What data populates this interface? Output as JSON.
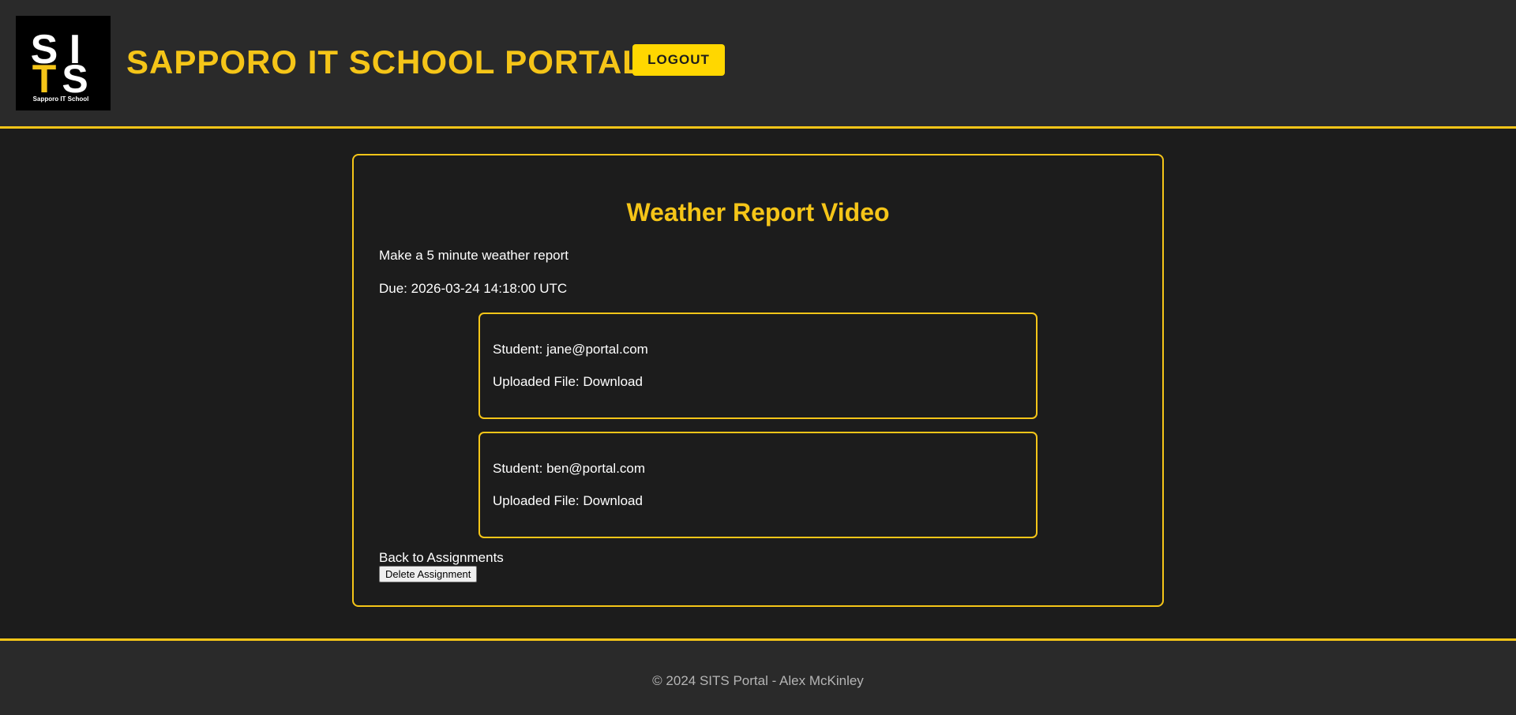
{
  "header": {
    "logo_letters": [
      "S",
      "I",
      "T",
      "S"
    ],
    "logo_caption": "Sapporo IT School",
    "title": "SAPPORO IT SCHOOL PORTAL",
    "logout_label": "LOGOUT"
  },
  "assignment": {
    "title": "Weather Report Video",
    "description": "Make a 5 minute weather report",
    "due": "Due: 2026-03-24 14:18:00 UTC"
  },
  "submissions": [
    {
      "student_prefix": "Student: ",
      "student": "jane@portal.com",
      "file_prefix": "Uploaded File: ",
      "file_link": "Download"
    },
    {
      "student_prefix": "Student: ",
      "student": "ben@portal.com",
      "file_prefix": "Uploaded File: ",
      "file_link": "Download"
    }
  ],
  "actions": {
    "back_link": "Back to Assignments",
    "delete_label": "Delete Assignment"
  },
  "footer": {
    "text": "© 2024 SITS Portal - Alex McKinley"
  },
  "colors": {
    "accent": "#f5c518",
    "button_yellow": "#ffd700",
    "background": "#1c1c1c",
    "header_bg": "#2a2a2a"
  }
}
